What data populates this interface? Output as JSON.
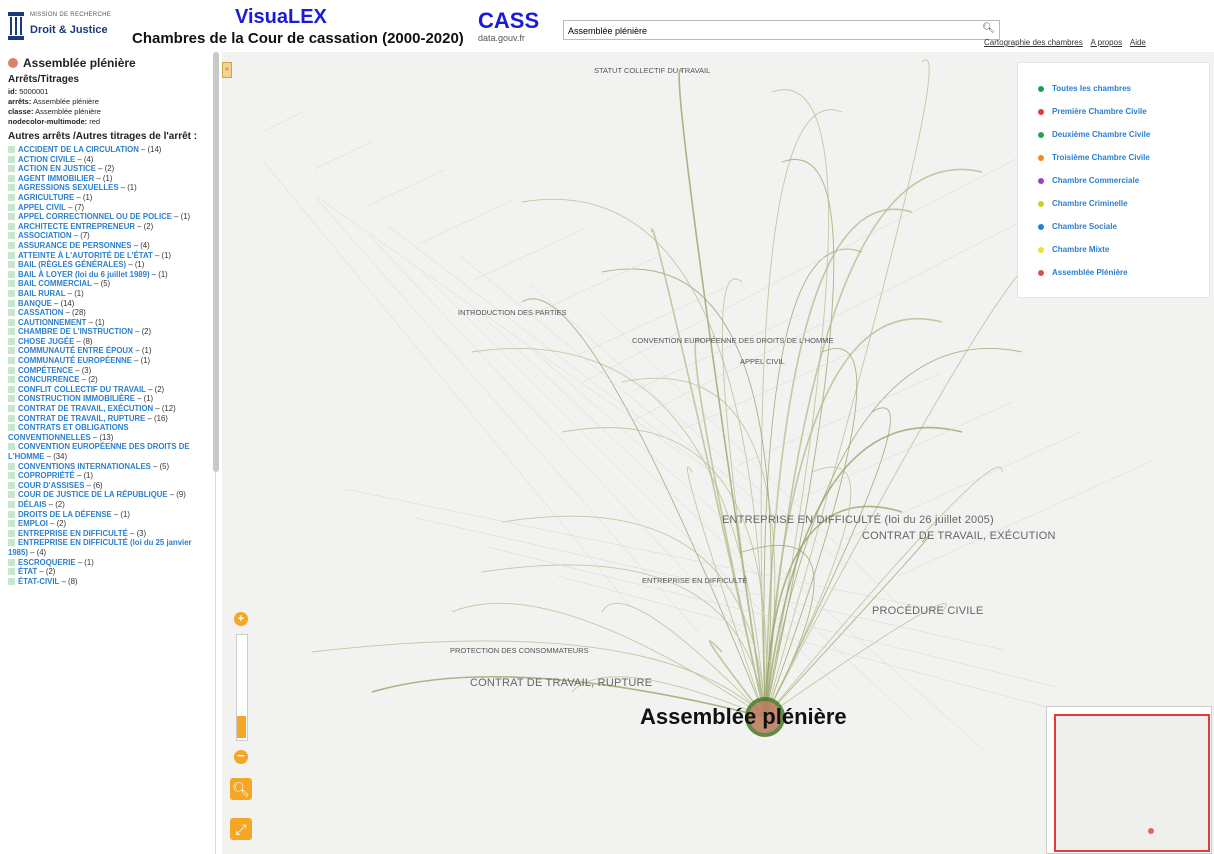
{
  "header": {
    "logo_line1": "MISSION DE RECHERCHE",
    "logo_line2": "Droit & Justice",
    "app_name": "VisuaLEX",
    "subtitle": "Chambres de la Cour de cassation (2000-2020)",
    "cass_title": "CASS",
    "cass_sub": "data.gouv.fr",
    "search_value": "Assemblée plénière",
    "links": [
      "Cartographie des chambres",
      "A propos",
      "Aide"
    ]
  },
  "sidebar": {
    "node_title": "Assemblée plénière",
    "section_head": "Arrêts/Titrages",
    "meta": [
      {
        "k": "id:",
        "v": "5000001"
      },
      {
        "k": "arrêts:",
        "v": "Assemblée plénière"
      },
      {
        "k": "classe:",
        "v": "Assemblée plénière"
      },
      {
        "k": "nodecolor-multimode:",
        "v": "red"
      }
    ],
    "autres_title": "Autres arrêts /Autres titrages de l'arrêt :",
    "items": [
      {
        "label": "ACCIDENT DE LA CIRCULATION",
        "count": "(14)"
      },
      {
        "label": "ACTION CIVILE",
        "count": "(4)"
      },
      {
        "label": "ACTION EN JUSTICE",
        "count": "(2)"
      },
      {
        "label": "AGENT IMMOBILIER",
        "count": "(1)"
      },
      {
        "label": "AGRESSIONS SEXUELLES",
        "count": "(1)"
      },
      {
        "label": "AGRICULTURE",
        "count": "(1)"
      },
      {
        "label": "APPEL CIVIL",
        "count": "(7)"
      },
      {
        "label": "APPEL CORRECTIONNEL OU DE POLICE",
        "count": "(1)"
      },
      {
        "label": "ARCHITECTE ENTREPRENEUR",
        "count": "(2)"
      },
      {
        "label": "ASSOCIATION",
        "count": "(7)"
      },
      {
        "label": "ASSURANCE DE PERSONNES",
        "count": "(4)"
      },
      {
        "label": "ATTEINTE À L'AUTORITÉ DE L'ÉTAT",
        "count": "(1)"
      },
      {
        "label": "BAIL (RÈGLES GÉNÉRALES)",
        "count": "(1)"
      },
      {
        "label": "BAIL À LOYER (loi du 6 juillet 1989)",
        "count": "(1)"
      },
      {
        "label": "BAIL COMMERCIAL",
        "count": "(5)"
      },
      {
        "label": "BAIL RURAL",
        "count": "(1)"
      },
      {
        "label": "BANQUE",
        "count": "(14)"
      },
      {
        "label": "CASSATION",
        "count": "(28)"
      },
      {
        "label": "CAUTIONNEMENT",
        "count": "(1)"
      },
      {
        "label": "CHAMBRE DE L'INSTRUCTION",
        "count": "(2)"
      },
      {
        "label": "CHOSE JUGÉE",
        "count": "(8)"
      },
      {
        "label": "COMMUNAUTÉ ENTRE ÉPOUX",
        "count": "(1)"
      },
      {
        "label": "COMMUNAUTÉ EUROPÉENNE",
        "count": "(1)"
      },
      {
        "label": "COMPÉTENCE",
        "count": "(3)"
      },
      {
        "label": "CONCURRENCE",
        "count": "(2)"
      },
      {
        "label": "CONFLIT COLLECTIF DU TRAVAIL",
        "count": "(2)"
      },
      {
        "label": "CONSTRUCTION IMMOBILIÈRE",
        "count": "(1)"
      },
      {
        "label": "CONTRAT DE TRAVAIL, EXÉCUTION",
        "count": "(12)"
      },
      {
        "label": "CONTRAT DE TRAVAIL, RUPTURE",
        "count": "(16)"
      },
      {
        "label": "CONTRATS ET OBLIGATIONS CONVENTIONNELLES",
        "count": "(13)"
      },
      {
        "label": "CONVENTION EUROPÉENNE DES DROITS DE L'HOMME",
        "count": "(34)"
      },
      {
        "label": "CONVENTIONS INTERNATIONALES",
        "count": "(5)"
      },
      {
        "label": "COPROPRIÉTÉ",
        "count": "(1)"
      },
      {
        "label": "COUR D'ASSISES",
        "count": "(6)"
      },
      {
        "label": "COUR DE JUSTICE DE LA RÉPUBLIQUE",
        "count": "(9)"
      },
      {
        "label": "DÉLAIS",
        "count": "(2)"
      },
      {
        "label": "DROITS DE LA DÉFENSE",
        "count": "(1)"
      },
      {
        "label": "EMPLOI",
        "count": "(2)"
      },
      {
        "label": "ENTREPRISE EN DIFFICULTÉ",
        "count": "(3)"
      },
      {
        "label": "ENTREPRISE EN DIFFICULTÉ (loi du 25 janvier 1985)",
        "count": "(4)"
      },
      {
        "label": "ESCROQUERIE",
        "count": "(1)"
      },
      {
        "label": "ÉTAT",
        "count": "(2)"
      },
      {
        "label": "ÉTAT-CIVIL",
        "count": "(8)"
      }
    ]
  },
  "legend": [
    {
      "label": "Toutes les chambres",
      "color": "#1e9e5a"
    },
    {
      "label": "Première Chambre Civile",
      "color": "#e23b3b"
    },
    {
      "label": "Deuxième Chambre Civile",
      "color": "#2aa24a"
    },
    {
      "label": "Troisième Chambre Civile",
      "color": "#f08a1a"
    },
    {
      "label": "Chambre Commerciale",
      "color": "#9b3fd1"
    },
    {
      "label": "Chambre Criminelle",
      "color": "#c8d12a"
    },
    {
      "label": "Chambre Sociale",
      "color": "#2a7fd0"
    },
    {
      "label": "Chambre Mixte",
      "color": "#f2e030"
    },
    {
      "label": "Assemblée Plénière",
      "color": "#d9524a"
    }
  ],
  "graph": {
    "main_label": "Assemblée plénière",
    "big_labels": [
      "PROCÉDURE CIVILE",
      "CONTRAT DE TRAVAIL, RUPTURE",
      "CONTRAT DE TRAVAIL, EXÉCUTION",
      "ENTREPRISE EN DIFFICULTÉ (loi du 26 juillet 2005)"
    ],
    "mid_labels": [
      "STATUT COLLECTIF DU TRAVAIL",
      "CONVENTION EUROPÉENNE DES DROITS DE L'HOMME",
      "INTRODUCTION DES PARTIES",
      "PROTECTION DES CONSOMMATEURS",
      "ENTREPRISE EN DIFFICULTÉ",
      "APPEL CIVIL"
    ]
  },
  "controls": {
    "zoom_in": "+",
    "zoom_out": "−",
    "collapse": "«"
  }
}
